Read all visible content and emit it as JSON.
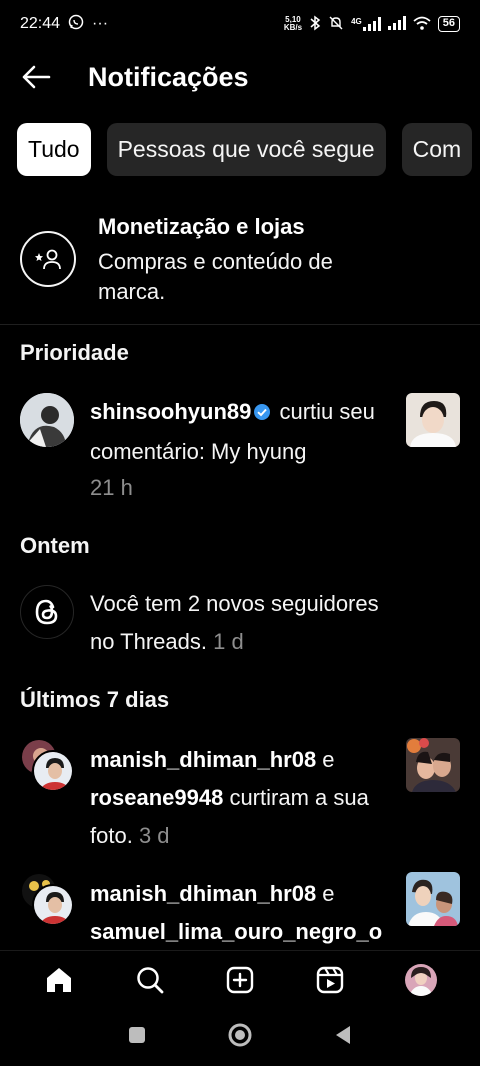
{
  "status_bar": {
    "time": "22:44",
    "dots": "···",
    "speed_top": "5,10",
    "speed_bottom": "KB/s",
    "network": "4G",
    "battery": "56"
  },
  "header": {
    "title": "Notificações"
  },
  "chips": [
    "Tudo",
    "Pessoas que você segue",
    "Com"
  ],
  "promo": {
    "title": "Monetização e lojas",
    "subtitle": "Compras e conteúdo de marca."
  },
  "sections": {
    "priority": "Prioridade",
    "yesterday": "Ontem",
    "last7": "Últimos 7 dias"
  },
  "notifications": [
    {
      "user": "shinsoohyun89",
      "text": " curtiu seu comentário: My hyung",
      "time": "21 h"
    },
    {
      "text": "Você tem 2 novos seguidores no Threads.",
      "time": "1 d"
    },
    {
      "user1": "manish_dhiman_hr08",
      "conj": " e ",
      "user2": "roseane9948",
      "text": " curtiram a sua foto.",
      "time": "3 d"
    },
    {
      "user1": "manish_dhiman_hr08",
      "conj": " e ",
      "user2": "samuel_lima_ouro_negro_o"
    }
  ],
  "icons": {
    "back": "arrow-left-icon",
    "promo": "person-star-icon",
    "verified": "verified-badge-icon",
    "threads": "threads-logo-icon",
    "home": "home-icon",
    "search": "search-icon",
    "create": "plus-square-icon",
    "reels": "reels-icon"
  },
  "colors": {
    "background": "#000000",
    "chip_bg": "#262626",
    "verified": "#3897f0",
    "muted": "#8e8e8e"
  }
}
